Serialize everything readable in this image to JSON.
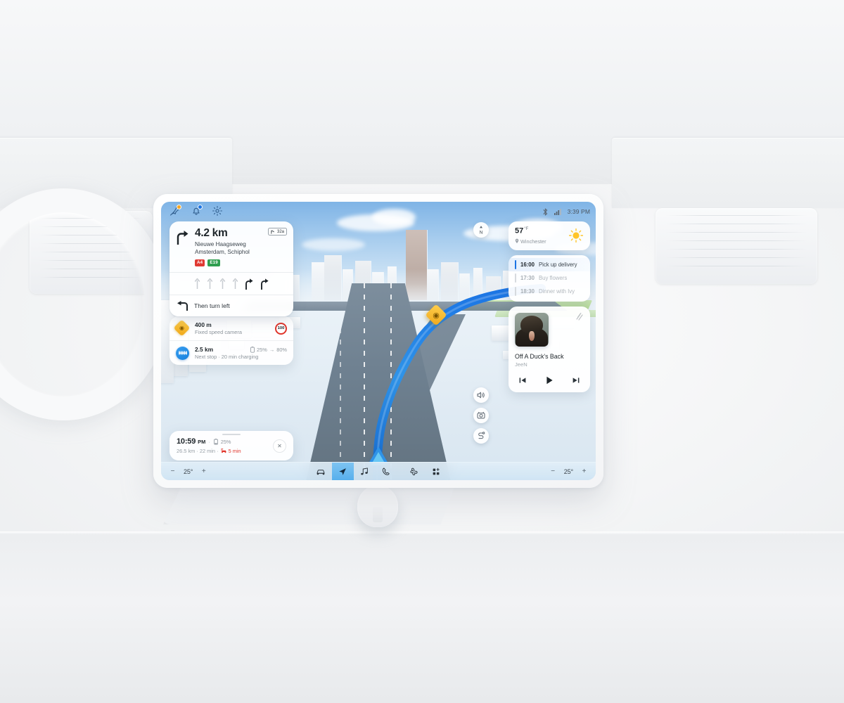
{
  "device": {
    "name": "Car infotainment display",
    "knob": "rotary-control-knob"
  },
  "statusbar": {
    "bluetooth_icon": "bluetooth-icon",
    "signal_icon": "cellular-signal-icon",
    "clock": "3:39 PM"
  },
  "quickbar": {
    "items": [
      {
        "icon": "pin-favorites-icon",
        "badge": "orange"
      },
      {
        "icon": "notifications-bell-icon",
        "badge": "blue"
      },
      {
        "icon": "settings-gear-icon",
        "badge": ""
      }
    ]
  },
  "navigation": {
    "distance": "4.2 km",
    "street": "Nieuwe Haagseweg",
    "destination_line": "Amsterdam, Schiphol",
    "exit_badge": "32a",
    "exit_icon": "motorway-exit-icon",
    "road_shields": [
      {
        "label": "A4",
        "color": "#e03a33"
      },
      {
        "label": "E19",
        "color": "#2f9e4f"
      }
    ],
    "maneuver_icon": "turn-right-icon",
    "lanes": [
      {
        "type": "straight",
        "active": false
      },
      {
        "type": "straight",
        "active": false
      },
      {
        "type": "straight",
        "active": false
      },
      {
        "type": "straight",
        "active": false
      },
      {
        "type": "right",
        "active": true
      },
      {
        "type": "right",
        "active": true
      }
    ],
    "then": {
      "icon": "turn-left-icon",
      "label": "Then turn left"
    }
  },
  "alerts": [
    {
      "icon": "speed-camera-icon",
      "icon_style": "orange-diamond",
      "title": "400 m",
      "subtitle": "Fixed speed camera",
      "right_badge": "100",
      "right_type": "speed-limit"
    },
    {
      "icon": "charging-station-icon",
      "icon_style": "blue-circle",
      "title": "2.5 km",
      "subtitle": "Next stop · 20 min charging",
      "battery_from": "25%",
      "battery_arrow": "→",
      "battery_to": "80%",
      "right_type": "battery"
    }
  ],
  "eta": {
    "arrival_time": "10:59",
    "arrival_ampm": "PM",
    "separator": "·",
    "battery_icon": "battery-icon",
    "battery_level": "25%",
    "summary": "26.5 km · 22 min ·",
    "delay_icon": "traffic-delay-icon",
    "delay": "5 min",
    "close_icon": "close-icon"
  },
  "map_controls": {
    "compass": {
      "icon": "compass-north-icon",
      "label": "N"
    },
    "buttons": [
      {
        "icon": "volume-icon"
      },
      {
        "icon": "camera-view-icon"
      },
      {
        "icon": "route-overview-icon"
      }
    ],
    "map_marker": {
      "icon": "speed-camera-marker-icon"
    }
  },
  "weather": {
    "temperature": "57",
    "unit": "°F",
    "location_icon": "location-pin-icon",
    "location": "Winchester",
    "condition_icon": "sunny-icon"
  },
  "calendar": {
    "events": [
      {
        "time": "16:00",
        "title": "Pick up delivery",
        "active": true
      },
      {
        "time": "17:30",
        "title": "Buy flowers",
        "active": false
      },
      {
        "time": "18:30",
        "title": "Dinner with Ivy",
        "active": false
      }
    ]
  },
  "media": {
    "album_art": "duck-album-cover",
    "eq_icon": "equalizer-icon",
    "title": "Off A Duck's Back",
    "artist": "JeeN",
    "controls": [
      {
        "icon": "previous-track-icon"
      },
      {
        "icon": "play-icon"
      },
      {
        "icon": "next-track-icon"
      }
    ]
  },
  "taskbar": {
    "left_climate": {
      "minus": "−",
      "value": "25°",
      "plus": "+"
    },
    "right_climate": {
      "minus": "−",
      "value": "25°",
      "plus": "+"
    },
    "apps": [
      {
        "icon": "car-icon",
        "active": false
      },
      {
        "icon": "navigation-arrow-icon",
        "active": true
      },
      {
        "icon": "music-note-icon",
        "active": false
      },
      {
        "icon": "phone-icon",
        "active": false
      },
      {
        "icon": "climate-fan-icon",
        "active": false
      },
      {
        "icon": "all-apps-grid-icon",
        "active": false
      }
    ]
  }
}
